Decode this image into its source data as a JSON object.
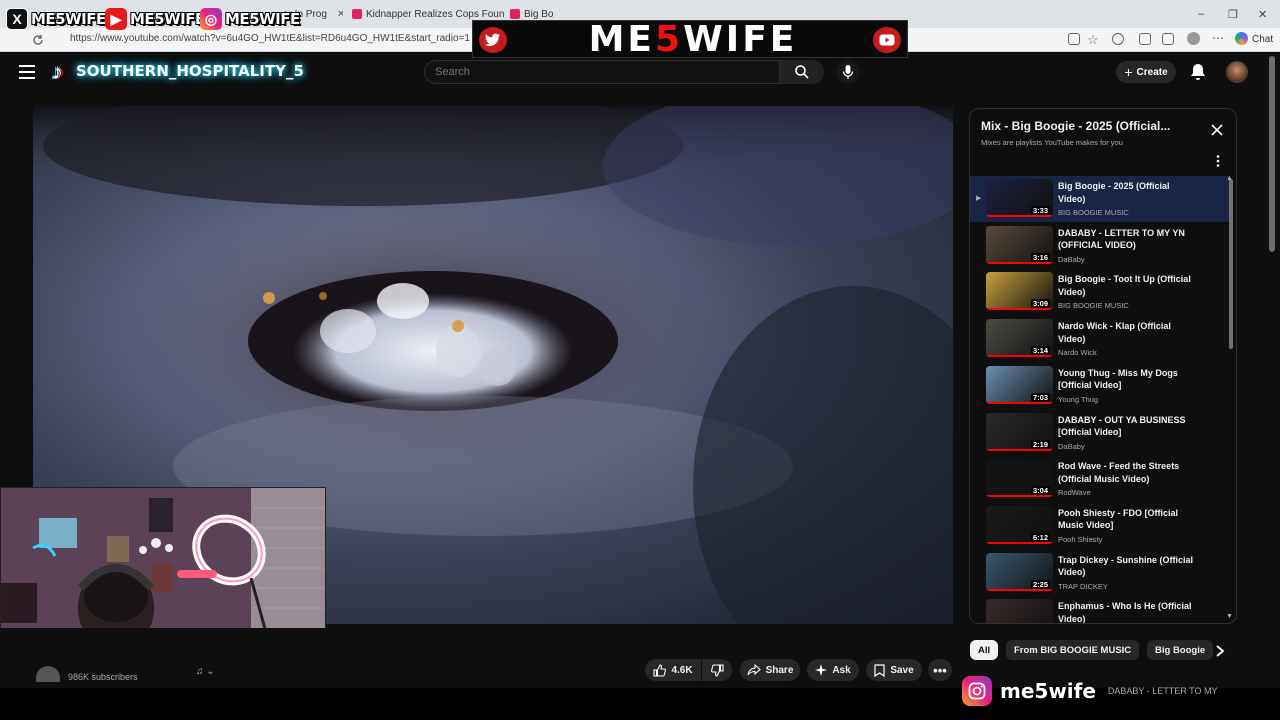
{
  "browser": {
    "tabs": [
      {
        "title": "er In Prog",
        "close": "✕"
      },
      {
        "title": "Kidnapper Realizes Cops Found Hi",
        "close": "✕"
      },
      {
        "title": "Big Bo",
        "close": ""
      }
    ],
    "url": "https://www.youtube.com/watch?v=6u4GO_HW1tE&list=RD6u4GO_HW1tE&start_radio=1",
    "chat_label": "Chat",
    "window_controls": [
      "–",
      "❐",
      "✕"
    ]
  },
  "overlay": {
    "socials": [
      {
        "platform": "x",
        "glyph": "X",
        "handle": "ME5WIFE",
        "color": "#111111"
      },
      {
        "platform": "youtube",
        "glyph": "▶",
        "handle": "ME5WIFE",
        "color": "#e5191c"
      },
      {
        "platform": "instagram",
        "glyph": "◎",
        "handle": "ME5WIFE",
        "color": "#d62976"
      }
    ],
    "banner": {
      "left": "ME",
      "five": "5",
      "right": "WIFE"
    },
    "tiktok_handle": "SOUTHERN_HOSPITALITY_5",
    "instagram_bottom": "me5wife",
    "instagram_bottom_trailing": "DABABY - LETTER TO MY"
  },
  "header": {
    "search_placeholder": "Search",
    "create_label": "Create"
  },
  "below_video": {
    "subscribers": "986K subscribers",
    "like_count": "4.6K",
    "share_label": "Share",
    "ask_label": "Ask",
    "save_label": "Save"
  },
  "playlist": {
    "title": "Mix - Big Boogie - 2025 (Official...",
    "subtitle": "Mixes are playlists YouTube makes for you",
    "items": [
      {
        "title": "Big Boogie - 2025 (Official Video)",
        "channel": "BIG BOOGIE MUSIC",
        "duration": "3:33",
        "active": true,
        "thumb": "#1d2140"
      },
      {
        "title": "DABABY - LETTER TO MY YN (OFFICIAL VIDEO)",
        "channel": "DaBaby",
        "duration": "3:16",
        "active": false,
        "thumb": "#5a4a3a"
      },
      {
        "title": "Big Boogie - Toot It Up (Official Video)",
        "channel": "BIG BOOGIE MUSIC",
        "duration": "3:09",
        "active": false,
        "thumb": "#c8a23a"
      },
      {
        "title": "Nardo Wick - Klap (Official Video)",
        "channel": "Nardo Wick",
        "duration": "3:14",
        "active": false,
        "thumb": "#4a4d44"
      },
      {
        "title": "Young Thug - Miss My Dogs [Official Video]",
        "channel": "Young Thug",
        "duration": "7:03",
        "active": false,
        "thumb": "#6a8fb0"
      },
      {
        "title": "DABABY - OUT YA BUSINESS [Official Video]",
        "channel": "DaBaby",
        "duration": "2:19",
        "active": false,
        "thumb": "#2a2a2a"
      },
      {
        "title": "Rod Wave - Feed the Streets (Official Music Video)",
        "channel": "RodWave",
        "duration": "3:04",
        "active": false,
        "thumb": "#151515"
      },
      {
        "title": "Pooh Shiesty - FDO [Official Music Video]",
        "channel": "Pooh Shiesty",
        "duration": "6:12",
        "active": false,
        "thumb": "#1a1a1a"
      },
      {
        "title": "Trap Dickey - Sunshine (Official Video)",
        "channel": "TRAP DICKEY",
        "duration": "2:25",
        "active": false,
        "thumb": "#3a5a70"
      },
      {
        "title": "Enphamus - Who Is He (Official Video)",
        "channel": "",
        "duration": "",
        "active": false,
        "thumb": "#3a2a2a"
      }
    ]
  },
  "chips": [
    "All",
    "From BIG BOOGIE MUSIC",
    "Big Boogie"
  ]
}
